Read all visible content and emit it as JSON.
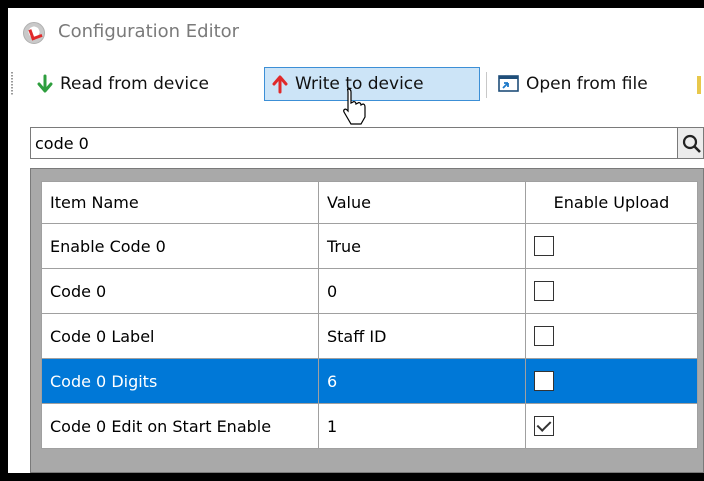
{
  "window": {
    "title": "Configuration Editor"
  },
  "toolbar": {
    "read_label": "Read from device",
    "write_label": "Write to device",
    "open_label": "Open from file"
  },
  "search": {
    "value": "code 0"
  },
  "table": {
    "headers": [
      "Item Name",
      "Value",
      "Enable Upload"
    ],
    "rows": [
      {
        "name": "Enable Code 0",
        "value": "True",
        "enable_upload": false,
        "selected": false
      },
      {
        "name": "Code 0",
        "value": "0",
        "enable_upload": false,
        "selected": false
      },
      {
        "name": "Code 0 Label",
        "value": "Staff ID",
        "enable_upload": false,
        "selected": false
      },
      {
        "name": "Code 0 Digits",
        "value": "6",
        "enable_upload": false,
        "selected": true
      },
      {
        "name": "Code 0 Edit on Start Enable",
        "value": "1",
        "enable_upload": true,
        "selected": false
      }
    ]
  },
  "colors": {
    "selection": "#0078d7",
    "hover_bg": "#cce4f7",
    "read_arrow": "#2e9e3e",
    "write_arrow": "#e0292a"
  }
}
